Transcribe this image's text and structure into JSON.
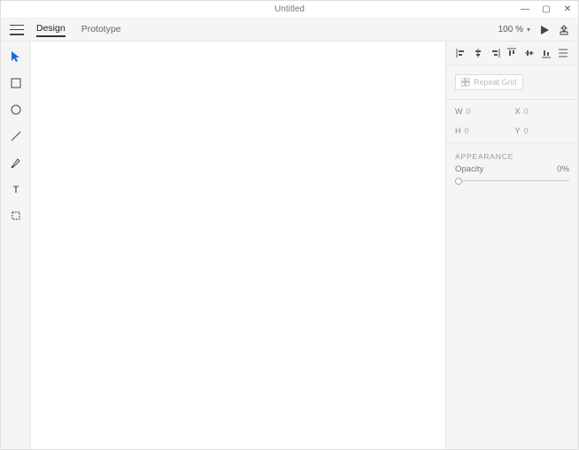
{
  "title": "Untitled",
  "windowControls": {
    "min": "—",
    "max": "▢",
    "close": "✕"
  },
  "tabs": {
    "design": "Design",
    "prototype": "Prototype"
  },
  "zoom": "100 %",
  "panel": {
    "repeatLabel": "Repeat Grid",
    "dims": {
      "w": {
        "label": "W",
        "value": "0"
      },
      "x": {
        "label": "X",
        "value": "0"
      },
      "h": {
        "label": "H",
        "value": "0"
      },
      "y": {
        "label": "Y",
        "value": "0"
      }
    },
    "appearanceHeader": "APPEARANCE",
    "opacityLabel": "Opacity",
    "opacityValue": "0%"
  }
}
